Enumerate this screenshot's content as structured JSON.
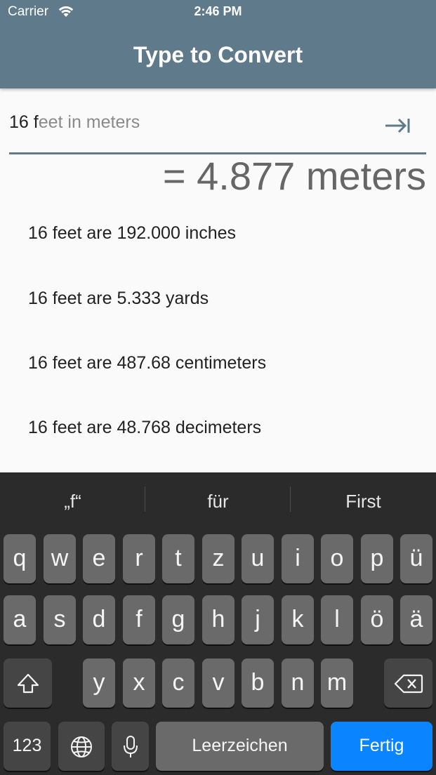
{
  "status": {
    "carrier": "Carrier",
    "time": "2:46 PM"
  },
  "app": {
    "title": "Type to Convert"
  },
  "input": {
    "typed": "16 f",
    "suggestion": "eet in meters"
  },
  "result": "= 4.877 meters",
  "conversions": [
    "16 feet are 192.000 inches",
    "16 feet are 5.333 yards",
    "16 feet are 487.68 centimeters",
    "16 feet are 48.768 decimeters"
  ],
  "keyboard": {
    "suggestions": [
      "„f“",
      "für",
      "First"
    ],
    "row1": [
      "q",
      "w",
      "e",
      "r",
      "t",
      "z",
      "u",
      "i",
      "o",
      "p",
      "ü"
    ],
    "row2": [
      "a",
      "s",
      "d",
      "f",
      "g",
      "h",
      "j",
      "k",
      "l",
      "ö",
      "ä"
    ],
    "row3": [
      "y",
      "x",
      "c",
      "v",
      "b",
      "n",
      "m"
    ],
    "numbers_label": "123",
    "space_label": "Leerzeichen",
    "done_label": "Fertig"
  }
}
